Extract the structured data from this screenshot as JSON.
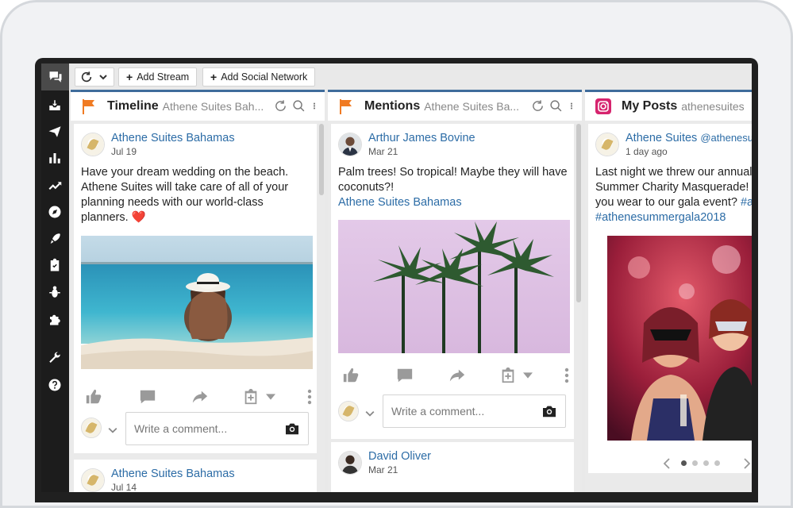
{
  "toolbar": {
    "add_stream": "Add Stream",
    "add_social_network": "Add Social Network"
  },
  "sidebar": {
    "items": [
      "streams-icon",
      "inbox-icon",
      "publisher-icon",
      "analytics-icon",
      "trending-icon",
      "explore-icon",
      "launch-icon",
      "assignments-icon",
      "bug-icon",
      "apps-icon",
      "tools-icon",
      "help-icon"
    ]
  },
  "columns": [
    {
      "title": "Timeline",
      "subtitle": "Athene Suites Bah...",
      "posts": [
        {
          "author": "Athene Suites Bahamas",
          "date": "Jul 19",
          "text": "Have your dream wedding on the beach. Athene Suites will take care of all of your planning needs with our world-class planners. ❤️",
          "comment_placeholder": "Write a comment..."
        },
        {
          "author": "Athene Suites Bahamas",
          "date": "Jul 14"
        }
      ]
    },
    {
      "title": "Mentions",
      "subtitle": "Athene Suites Ba...",
      "posts": [
        {
          "author": "Arthur James Bovine",
          "date": "Mar 21",
          "text": "Palm trees! So tropical! Maybe they will have coconuts?!",
          "mention": "Athene Suites Bahamas",
          "comment_placeholder": "Write a comment..."
        },
        {
          "author": "David Oliver",
          "date": "Mar 21"
        }
      ]
    },
    {
      "title": "My Posts",
      "subtitle": "athenesuites",
      "posts": [
        {
          "author": "Athene Suites",
          "handle": "@athenesui",
          "date": "1 day ago",
          "text": "Last night we threw our annual Summer Charity Masquerade! W you wear to our gala event?",
          "hashtag1": "#a",
          "hashtag2": "#athenesummergala2018"
        }
      ],
      "carousel": {
        "total": 4,
        "active": 1
      }
    }
  ],
  "colors": {
    "accent_blue": "#2c6ca6",
    "column_border": "#3f6c9b",
    "flag_orange": "#f07b23",
    "instagram": "#d6246e"
  }
}
